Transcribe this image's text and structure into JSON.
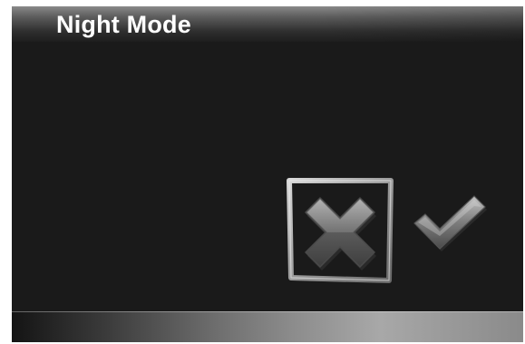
{
  "title_bar": {
    "title": "Night Mode"
  },
  "dialog": {
    "cancel_icon": "cross-icon",
    "confirm_icon": "checkmark-icon",
    "selected": "cancel"
  }
}
